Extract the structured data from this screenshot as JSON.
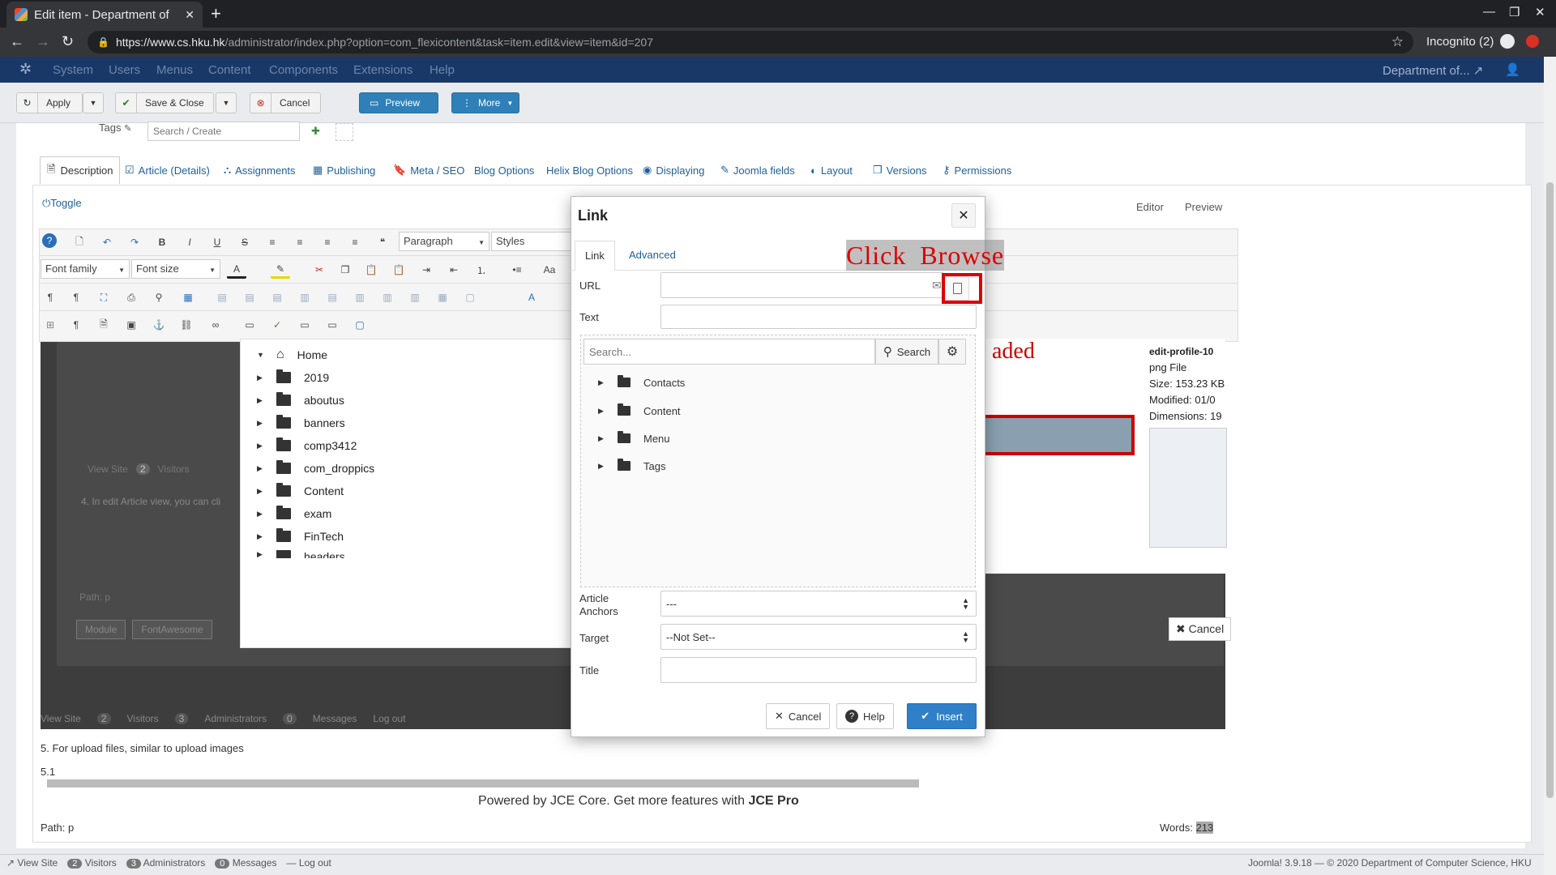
{
  "browser": {
    "tab_title": "Edit item - Department of",
    "url_host": "https://www.cs.hku.hk",
    "url_path": "/administrator/index.php?option=com_flexicontent&task=item.edit&view=item&id=207",
    "profile": "Incognito (2)"
  },
  "joomla": {
    "menu": [
      "System",
      "Users",
      "Menus",
      "Content",
      "Components",
      "Extensions",
      "Help"
    ],
    "site_link": "Department of..."
  },
  "toolbar": {
    "apply": "Apply",
    "save_close": "Save & Close",
    "cancel": "Cancel",
    "preview": "Preview",
    "more": "More"
  },
  "tags": {
    "label": "Tags",
    "placeholder": "Search / Create"
  },
  "editor_tabs": [
    "Description",
    "Article (Details)",
    "Assignments",
    "Publishing",
    "Meta / SEO",
    "Blog Options",
    "Helix Blog Options",
    "Displaying",
    "Joomla fields",
    "Layout",
    "Versions",
    "Permissions"
  ],
  "editor": {
    "toggle": "Toggle",
    "editor_link": "Editor",
    "preview_link": "Preview",
    "format_select": "Paragraph",
    "styles_select": "Styles",
    "font_family": "Font family",
    "font_size": "Font size"
  },
  "background": {
    "file_tree": [
      "Home",
      "2019",
      "aboutus",
      "banners",
      "comp3412",
      "com_droppics",
      "Content",
      "exam",
      "FinTech",
      "headers"
    ],
    "file_info": {
      "name": "edit-profile-10",
      "type": "png File",
      "size": "Size: 153.23 KB",
      "modified": "Modified: 01/0",
      "dimensions": "Dimensions: 19"
    },
    "uploaded_text": "aded",
    "cancel": "Cancel",
    "inner_view_site": "View Site",
    "inner_visitors": "Visitors",
    "inner_path": "Path: p",
    "inner_module": "Module",
    "inner_fontawesome": "FontAwesome",
    "article_hint": "4. In edit Article view, you can cli",
    "status_row": [
      "View Site",
      "Visitors",
      "Administrators",
      "Messages",
      "Log out"
    ],
    "status_counts": [
      "2",
      "3",
      "0"
    ],
    "inner_counts": [
      "2"
    ]
  },
  "content": {
    "line5": "5. For upload files, similar to upload images",
    "line51": "5.1",
    "powered_prefix": "Powered by JCE Core. Get more features with ",
    "powered_strong": "JCE Pro",
    "path": "Path: p",
    "words_label": "Words: ",
    "words_count": "213"
  },
  "status_bar": {
    "items": [
      "View Site",
      "Visitors",
      "Administrators",
      "Messages",
      "Log out"
    ],
    "counts": [
      "2",
      "3",
      "0"
    ],
    "right": "Joomla! 3.9.18  —  © 2020 Department of Computer Science, HKU"
  },
  "modal": {
    "title": "Link",
    "tab_link": "Link",
    "tab_advanced": "Advanced",
    "annotation": "Click  Browse",
    "url_label": "URL",
    "url_value": "",
    "text_label": "Text",
    "text_value": "",
    "search_placeholder": "Search...",
    "search_button": "Search",
    "tree": [
      "Contacts",
      "Content",
      "Menu",
      "Tags"
    ],
    "anchors_label_1": "Article",
    "anchors_label_2": "Anchors",
    "anchors_value": "---",
    "target_label": "Target",
    "target_value": "--Not Set--",
    "title_label": "Title",
    "title_value": "",
    "cancel": "Cancel",
    "help": "Help",
    "insert": "Insert"
  }
}
